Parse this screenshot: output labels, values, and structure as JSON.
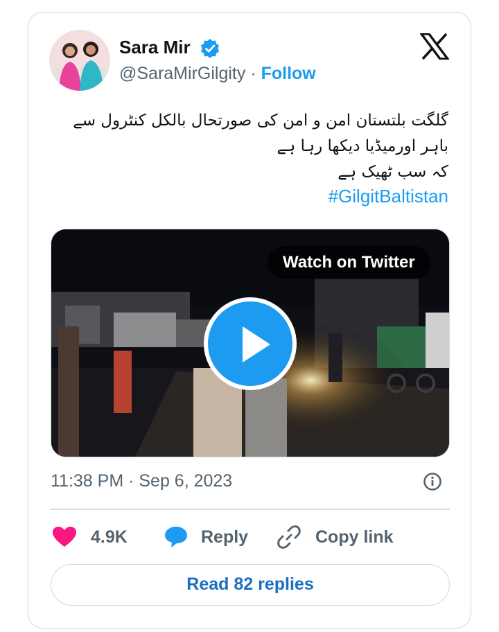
{
  "author": {
    "name": "Sara Mir",
    "handle": "@SaraMirGilgity",
    "separator": "·",
    "follow_label": "Follow"
  },
  "tweet": {
    "lines": [
      "گلگت بلتستان امن و امن کی صورتحال بالکل کنٹرول سے",
      "باہر اورمیڈیا دیکھا رہا ہے",
      "کہ سب ٹھیک ہے"
    ],
    "hashtag": "#GilgitBaltistan"
  },
  "media": {
    "watch_label": "Watch on Twitter"
  },
  "timestamp": "11:38 PM · Sep 6, 2023",
  "actions": {
    "likes": "4.9K",
    "reply": "Reply",
    "copy_link": "Copy link"
  },
  "read_replies": "Read 82 replies",
  "colors": {
    "accent": "#1d9bf0",
    "heart": "#f91880",
    "muted": "#536471",
    "border": "#cfd9de"
  },
  "icons": [
    "verified-badge-icon",
    "x-logo-icon",
    "play-icon",
    "info-icon",
    "heart-icon",
    "reply-bubble-icon",
    "link-icon"
  ]
}
